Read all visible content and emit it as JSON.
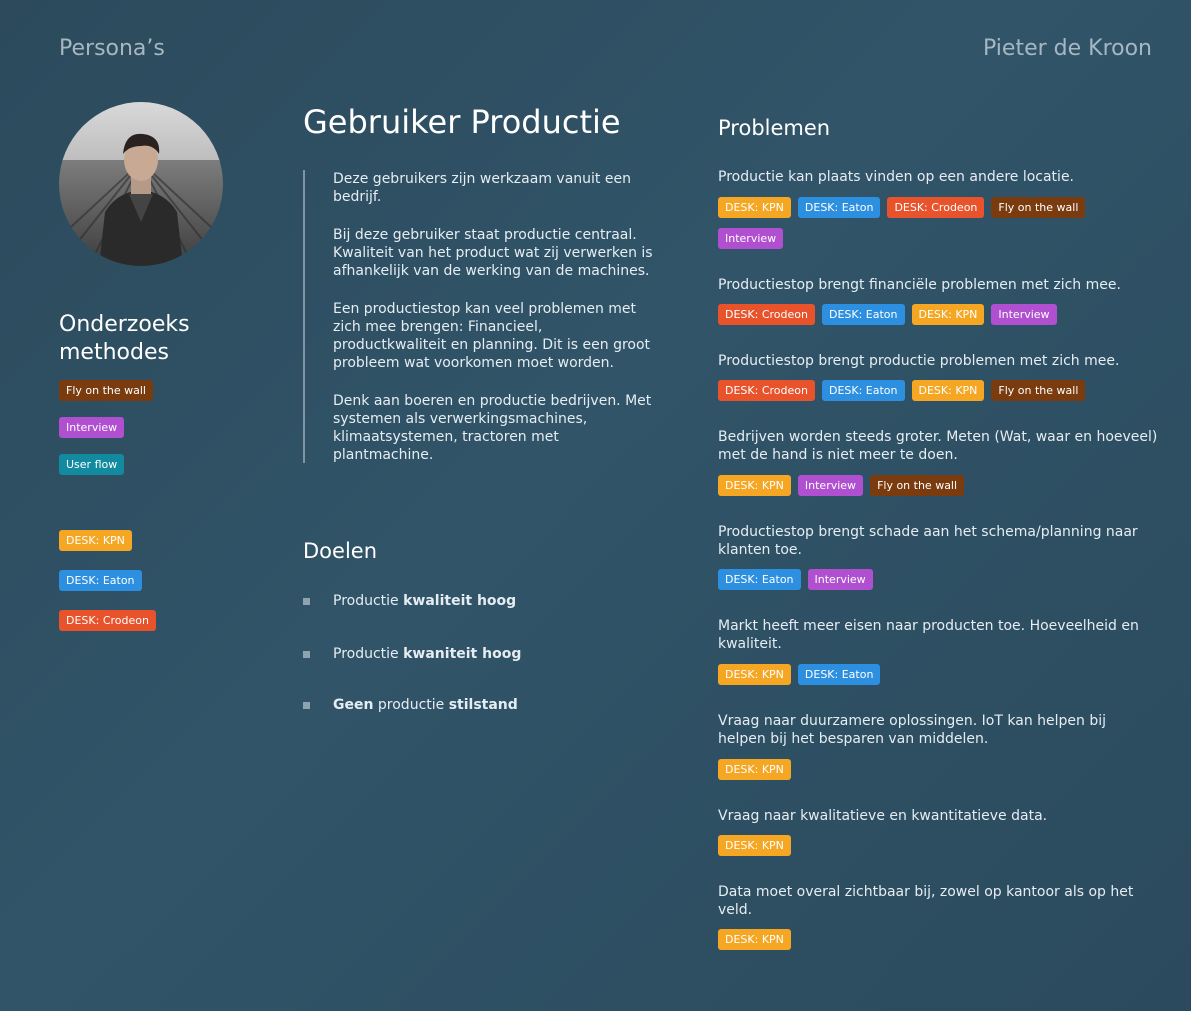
{
  "header": {
    "left": "Persona’s",
    "right": "Pieter de Kroon"
  },
  "colors": {
    "kpn": "#f5a623",
    "eaton": "#2d8fe0",
    "crodeon": "#e8532c",
    "fly": "#7a3b0e",
    "interview": "#b04fd0",
    "userflow": "#128aa0"
  },
  "sidebar": {
    "methods_title": "Onderzoeks methodes",
    "methods": [
      "Fly on the wall",
      "Interview",
      "User flow"
    ],
    "desk": [
      "DESK: KPN",
      "DESK: Eaton",
      "DESK: Crodeon"
    ]
  },
  "persona": {
    "title": "Gebruiker Productie",
    "paragraphs": [
      "Deze gebruikers zijn werkzaam vanuit een bedrijf.",
      "Bij deze gebruiker staat productie centraal. Kwaliteit van het product wat zij verwerken is afhankelijk van de werking van de machines.",
      "Een productiestop kan veel problemen met zich mee brengen: Financieel, productkwaliteit en planning. Dit is een groot probleem wat voorkomen moet worden.",
      "Denk aan boeren en productie bedrijven. Met systemen als verwerkingsmachines, klimaatsystemen, tractoren met plantmachine."
    ]
  },
  "goals": {
    "title": "Doelen",
    "items": [
      {
        "a": "Productie ",
        "b": "kwaliteit hoog",
        "c": ""
      },
      {
        "a": "Productie ",
        "b": "kwaniteit hoog",
        "c": ""
      },
      {
        "a": "",
        "b": "Geen",
        "c": " productie ",
        "d": "stilstand"
      }
    ]
  },
  "problems": {
    "title": "Problemen",
    "items": [
      {
        "text": "Productie kan plaats vinden op een andere locatie.",
        "tags": [
          "DESK: KPN",
          "DESK: Eaton",
          "DESK: Crodeon",
          "Fly on the wall",
          "Interview"
        ]
      },
      {
        "text": "Productiestop brengt financiële problemen met zich mee.",
        "tags": [
          "DESK: Crodeon",
          "DESK: Eaton",
          "DESK: KPN",
          "Interview"
        ]
      },
      {
        "text": "Productiestop brengt productie problemen met zich mee.",
        "tags": [
          "DESK: Crodeon",
          "DESK: Eaton",
          "DESK: KPN",
          "Fly on the wall"
        ]
      },
      {
        "text": "Bedrijven worden steeds groter. Meten (Wat, waar en hoeveel) met de hand is niet meer te doen.",
        "tags": [
          "DESK: KPN",
          "Interview",
          "Fly on the wall"
        ]
      },
      {
        "text": "Productiestop brengt schade aan het schema/planning naar klanten toe.",
        "tags": [
          "DESK: Eaton",
          "Interview"
        ]
      },
      {
        "text": "Markt heeft meer eisen naar producten toe. Hoeveelheid en kwaliteit.",
        "tags": [
          "DESK: KPN",
          "DESK: Eaton"
        ]
      },
      {
        "text": "Vraag naar duurzamere oplossingen. IoT kan helpen bij helpen bij het besparen van middelen.",
        "tags": [
          "DESK: KPN"
        ]
      },
      {
        "text": "Vraag naar kwalitatieve en kwantitatieve data.",
        "tags": [
          "DESK: KPN"
        ]
      },
      {
        "text": "Data moet overal zichtbaar bij, zowel op kantoor als op het veld.",
        "tags": [
          "DESK: KPN"
        ]
      }
    ]
  }
}
